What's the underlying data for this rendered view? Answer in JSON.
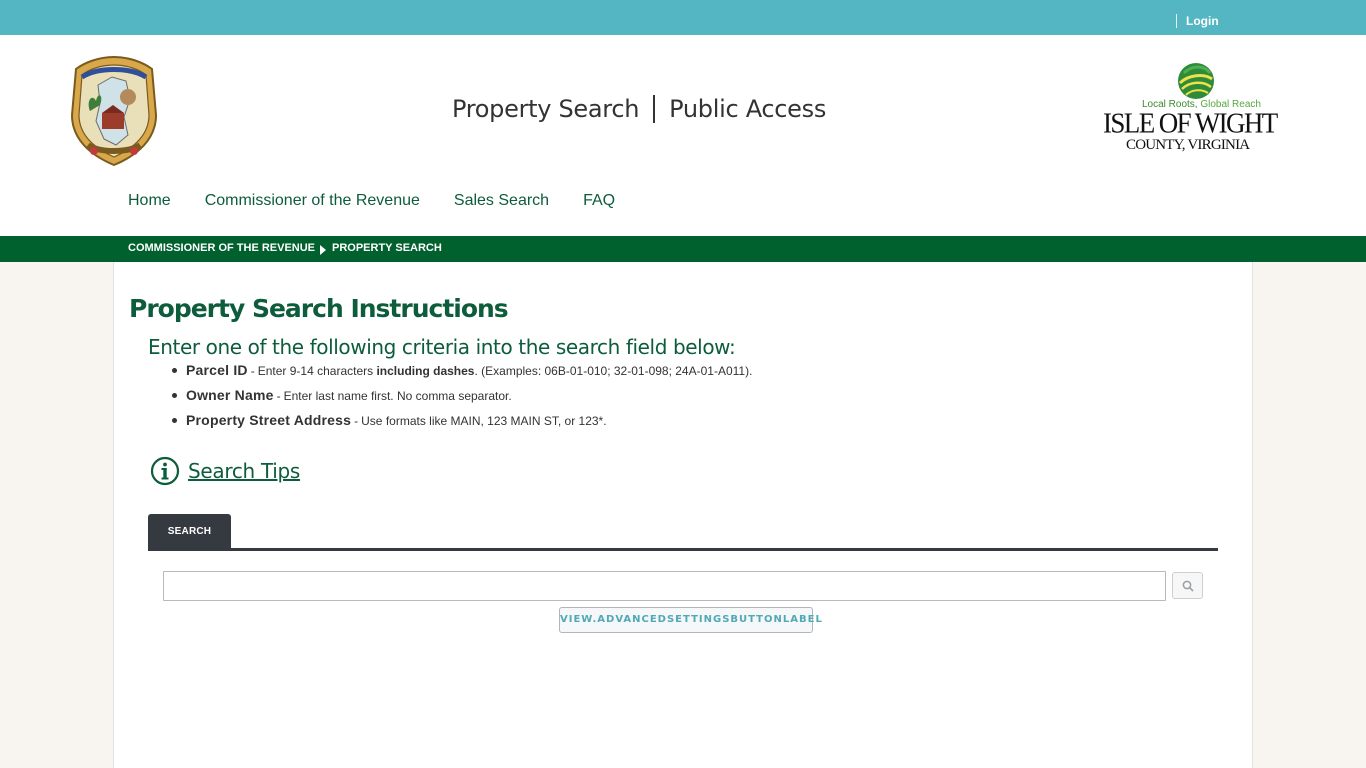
{
  "topbar": {
    "login_label": "Login"
  },
  "header": {
    "title_left": "Property Search",
    "title_right": "Public Access",
    "seal": {
      "text_top": "ISLE OF WIGHT",
      "text_bottom": "VIRGINIA"
    },
    "brand": {
      "tagline_a": "Local Roots,",
      "tagline_b": "Global Reach",
      "name": "ISLE OF WIGHT",
      "subname": "COUNTY, VIRGINIA"
    }
  },
  "nav": {
    "items": [
      {
        "label": "Home"
      },
      {
        "label": "Commissioner of the Revenue"
      },
      {
        "label": "Sales Search"
      },
      {
        "label": "FAQ"
      }
    ]
  },
  "breadcrumb": {
    "parent": "COMMISSIONER OF THE REVENUE",
    "current": "PROPERTY SEARCH"
  },
  "instructions": {
    "heading": "Property Search Instructions",
    "lead": "Enter one of the following criteria into the search field below:",
    "criteria": [
      {
        "term": "Parcel ID",
        "text_a": "Enter 9-14 characters ",
        "bold": "including dashes",
        "text_b": ". (Examples: 06B-01-010; 32-01-098; 24A-01-A011)."
      },
      {
        "term": "Owner Name",
        "text_a": "Enter last name first. No comma separator.",
        "bold": "",
        "text_b": ""
      },
      {
        "term": "Property Street Address",
        "text_a": "Use formats like MAIN, 123 MAIN ST, or 123*.",
        "bold": "",
        "text_b": ""
      }
    ],
    "dash": "-",
    "search_tips_label": "Search Tips"
  },
  "search": {
    "tab_label": "SEARCH",
    "input_value": "",
    "placeholder": "",
    "advanced_button_label": "VIEW.ADVANCEDSETTINGSBUTTONLABEL"
  },
  "colors": {
    "topbar": "#54b6c3",
    "brand_green": "#00612e",
    "heading_green": "#0d5c3c",
    "tab_dark": "#343a40"
  }
}
